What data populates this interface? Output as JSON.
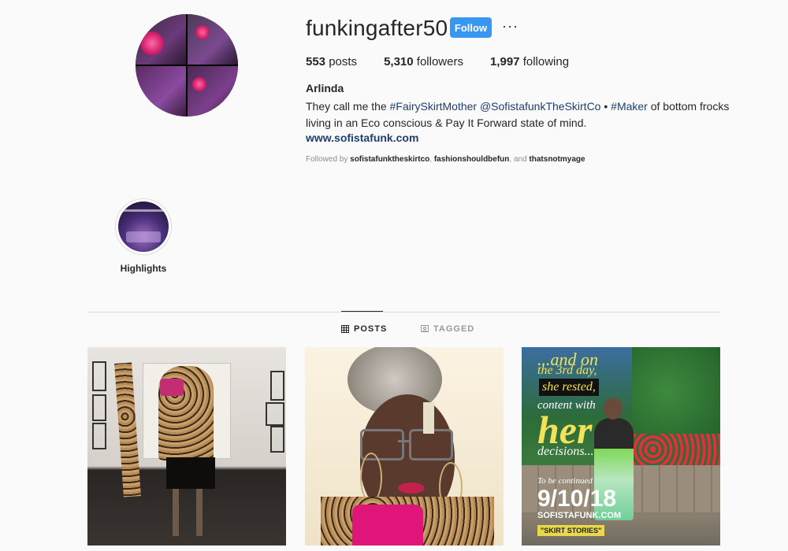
{
  "profile": {
    "username": "funkingafter50",
    "follow_label": "Follow",
    "more_icon": "···",
    "stats": [
      {
        "count": "553",
        "label": "posts"
      },
      {
        "count": "5,310",
        "label": "followers"
      },
      {
        "count": "1,997",
        "label": "following"
      }
    ],
    "full_name": "Arlinda",
    "bio": {
      "part1": "They call me the ",
      "tag1": "#FairySkirtMother",
      "space1": " ",
      "tag2": "@SofistafunkTheSkirtCo",
      "bullet": " • ",
      "tag3": "#Maker",
      "part2": " of bottom frocks living in an Eco conscious & Pay It Forward state of mind."
    },
    "website": "www.sofistafunk.com",
    "followed_by": {
      "prefix": "Followed by ",
      "user1": "sofistafunktheskirtco",
      "sep": ", ",
      "user2": "fashionshouldbefun",
      "and": ", and ",
      "user3": "thatsnotmyage"
    }
  },
  "highlights": [
    {
      "label": "Highlights"
    }
  ],
  "tabs": [
    {
      "label": "POSTS",
      "icon": "grid-icon",
      "active": true
    },
    {
      "label": "TAGGED",
      "icon": "tag-icon",
      "active": false
    }
  ],
  "posts": [
    {
      "alt": "leopard outfit photo"
    },
    {
      "alt": "portrait with glasses"
    },
    {
      "overlay": {
        "line1": "...and on",
        "line2": "the 3rd day,",
        "line3": "she rested,",
        "line4": "content with",
        "line5": "her",
        "line6": "decisions...",
        "line7": "To be continued",
        "line8": "9/10/18",
        "line9": "SOFISTAFUNK.COM",
        "line10": "\"SKIRT STORIES\""
      }
    }
  ],
  "colors": {
    "follow_button": "#3897f0",
    "link": "#1e3f6b",
    "background": "#fafafa",
    "overlay_yellow": "#f2e15a"
  }
}
